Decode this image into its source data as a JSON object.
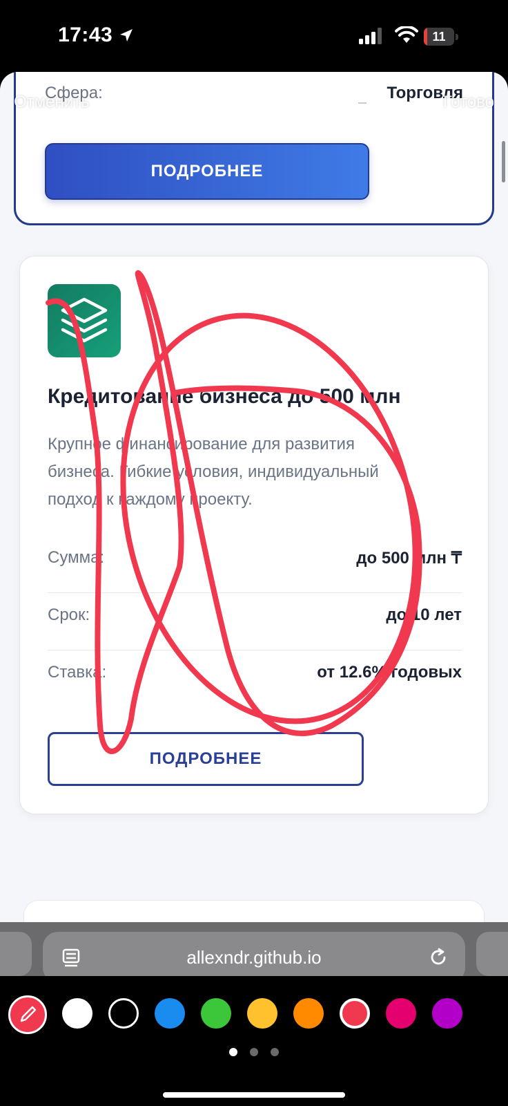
{
  "status_bar": {
    "time": "17:43",
    "battery_level": "11",
    "battery_fraction": 0.11,
    "battery_color": "#e5433a",
    "icons": [
      "location-arrow-icon",
      "cellular-signal-icon",
      "wifi-icon",
      "battery-icon"
    ]
  },
  "markup_toolbar": {
    "cancel_label": "Отменить",
    "done_label": "Готово",
    "tools": [
      "pen-tool-icon",
      "marker-tool-icon",
      "pencil-tool-icon",
      "lasso-tool-icon",
      "eraser-tool-icon"
    ]
  },
  "top_card": {
    "row_label": "Сфера:",
    "row_value": "Торговля",
    "button_label": "ПОДРОБНЕЕ"
  },
  "loan_card": {
    "icon": "layers-icon",
    "icon_colors": [
      "#137b61",
      "#16a079"
    ],
    "title": "Кредитование бизнеса до 500 млн",
    "description_lines": [
      "Крупное финансирование для развития",
      "бизнеса. Гибкие условия, индивидуальный",
      "подход к каждому проекту."
    ],
    "rows": [
      {
        "label": "Сумма:",
        "value": "до 500 млн ₸"
      },
      {
        "label": "Срок:",
        "value": "до 10 лет"
      },
      {
        "label": "Ставка:",
        "value": "от 12.6% годовых"
      }
    ],
    "button_label": "ПОДРОБНЕЕ"
  },
  "browser": {
    "url": "allexndr.github.io",
    "icons": [
      "page-menu-icon",
      "reload-icon"
    ]
  },
  "palette": {
    "selected_tool": "pen-icon",
    "selected_color": "#f0394f",
    "colors": [
      "#ffffff",
      "#000000",
      "#1a8cf0",
      "#3cc63a",
      "#ffc12e",
      "#ff8a00",
      "#f0394f",
      "#e5006f",
      "#b200c9"
    ],
    "page_indicator": {
      "count": 3,
      "active": 0
    }
  },
  "accent_colors": {
    "primary_blue": "#233a8f",
    "drawing_red": "#f0394f"
  }
}
